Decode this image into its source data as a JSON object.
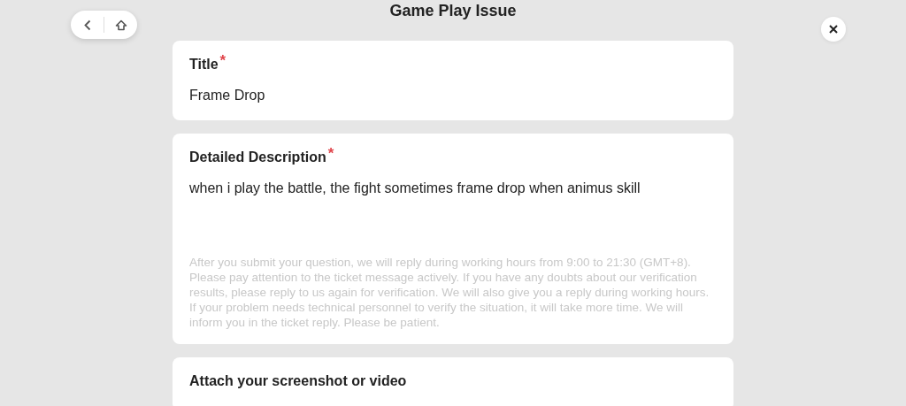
{
  "header": {
    "title": "Game Play Issue"
  },
  "fields": [
    {
      "kind": "input",
      "label": "Title",
      "required_mark": "*",
      "value": "Frame Drop"
    },
    {
      "kind": "textarea",
      "label": "Detailed Description",
      "required_mark": "*",
      "value": "when i play the battle, the fight sometimes frame drop when animus skill",
      "notice": "After you submit your question, we will reply during working hours from 9:00 to 21:30 (GMT+8). Please pay attention to the ticket message actively. If you have any doubts about our verification results, please reply to us again for verification. We will also give you a reply during working hours. If your problem needs technical personnel to verify the situation, it will take more time. We will inform you in the ticket reply. Please be patient."
    },
    {
      "kind": "upload",
      "label": "Attach your screenshot or video"
    }
  ]
}
